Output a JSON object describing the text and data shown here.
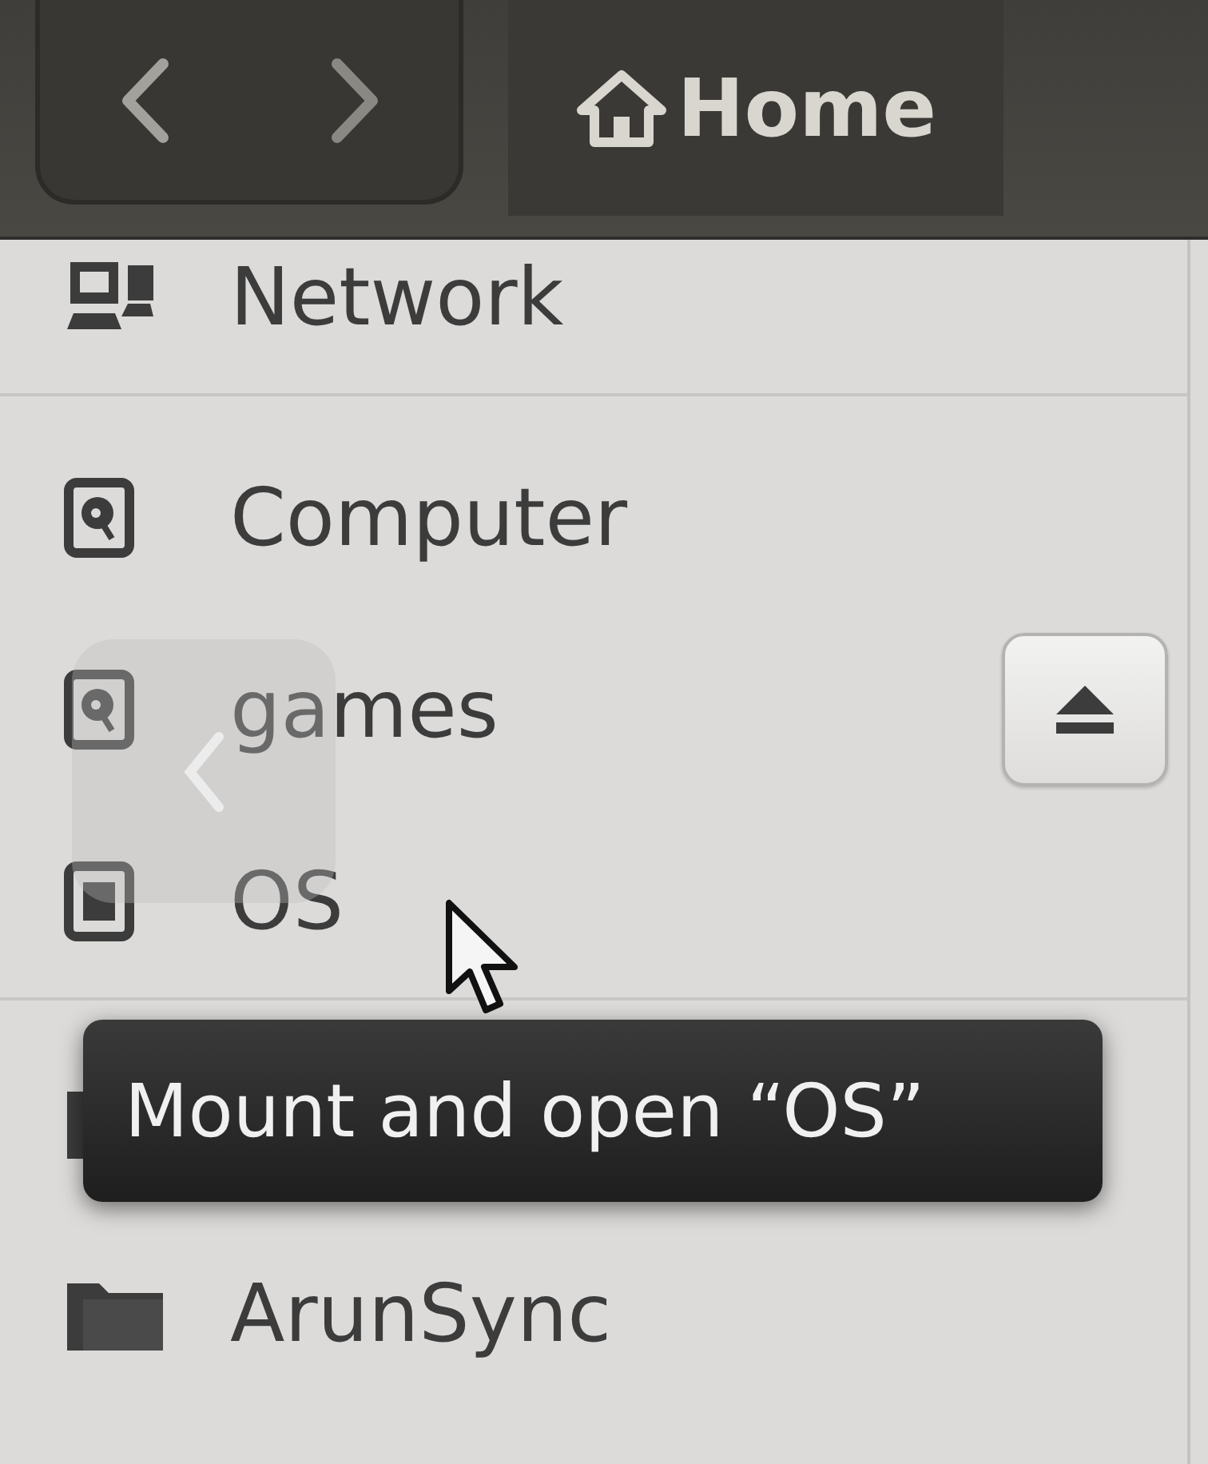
{
  "toolbar": {
    "path_buttons": [
      {
        "label": "Home",
        "selected": true
      }
    ]
  },
  "sidebar": {
    "groups": [
      {
        "items": [
          {
            "kind": "network",
            "label": "Network"
          }
        ]
      },
      {
        "items": [
          {
            "kind": "drive",
            "label": "Computer"
          },
          {
            "kind": "volume",
            "label": "games",
            "mounted": true
          },
          {
            "kind": "volume",
            "label": "OS",
            "mounted": false
          }
        ]
      },
      {
        "items": [
          {
            "kind": "folder"
          },
          {
            "kind": "folder",
            "label": "ArunSync"
          }
        ]
      }
    ]
  },
  "tooltip": {
    "text": "Mount and open “OS”"
  }
}
